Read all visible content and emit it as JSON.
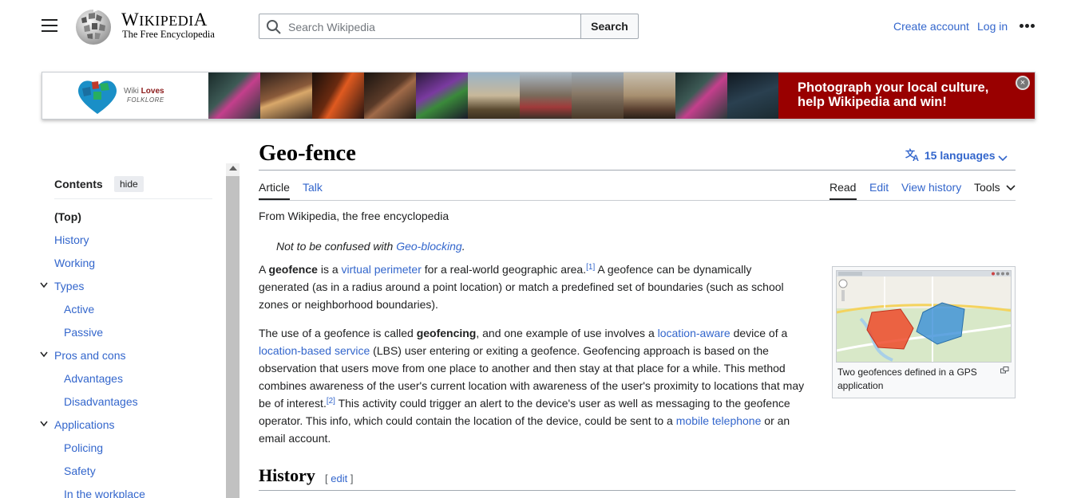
{
  "header": {
    "wordmark_first": "W",
    "wordmark_rest": "IKIPEDI",
    "wordmark_last": "A",
    "tagline": "The Free Encyclopedia",
    "search_placeholder": "Search Wikipedia",
    "search_button": "Search",
    "create_account": "Create account",
    "log_in": "Log in"
  },
  "banner": {
    "logo_text_wiki": "Wiki",
    "logo_text_loves": "Loves",
    "logo_text_folklore": "FOLKLORE",
    "promo": "Photograph your local culture, help Wikipedia and win!",
    "close_glyph": "×"
  },
  "toc": {
    "title": "Contents",
    "hide": "hide",
    "items": [
      {
        "label": "(Top)",
        "level": 1,
        "bold": true
      },
      {
        "label": "History",
        "level": 1
      },
      {
        "label": "Working",
        "level": 1
      },
      {
        "label": "Types",
        "level": 1,
        "expandable": true
      },
      {
        "label": "Active",
        "level": 2
      },
      {
        "label": "Passive",
        "level": 2
      },
      {
        "label": "Pros and cons",
        "level": 1,
        "expandable": true
      },
      {
        "label": "Advantages",
        "level": 2
      },
      {
        "label": "Disadvantages",
        "level": 2
      },
      {
        "label": "Applications",
        "level": 1,
        "expandable": true
      },
      {
        "label": "Policing",
        "level": 2
      },
      {
        "label": "Safety",
        "level": 2
      },
      {
        "label": "In the workplace",
        "level": 2
      }
    ]
  },
  "article": {
    "title": "Geo-fence",
    "languages": "15 languages",
    "tabs": {
      "article": "Article",
      "talk": "Talk",
      "read": "Read",
      "edit": "Edit",
      "view_history": "View history",
      "tools": "Tools"
    },
    "from_wiki": "From Wikipedia, the free encyclopedia",
    "hatnote_prefix": "Not to be confused with ",
    "hatnote_link": "Geo-blocking",
    "hatnote_suffix": ".",
    "p1": {
      "t1": "A ",
      "b1": "geofence",
      "t2": " is a ",
      "l1": "virtual perimeter",
      "t3": " for a real-world geographic area.",
      "ref1": "[1]",
      "t4": " A geofence can be dynamically",
      "line2": "generated (as in a radius around a point location) or match a predefined set of boundaries (such as school",
      "line3": "zones or neighborhood boundaries)."
    },
    "p2": {
      "t1": "The use of a geofence is called ",
      "b1": "geofencing",
      "t2": ", and one example of use involves a ",
      "l1": "location-aware",
      "t3": " device of a",
      "l2": "location-based service",
      "t4": " (LBS) user entering or exiting a geofence. Geofencing approach is based on the",
      "line3": "observation that users move from one place to another and then stay at that place for a while. This method",
      "line4": "combines awareness of the user's current location with awareness of the user's proximity to locations that may",
      "t5": "be of interest.",
      "ref2": "[2]",
      "t6": " This activity could trigger an alert to the device's user as well as messaging to the geofence",
      "t7": "operator. This info, which could contain the location of the device, could be sent to a ",
      "l3": "mobile telephone",
      "t8": " or an",
      "line7": "email account."
    },
    "figure_caption": "Two geofences defined in a GPS application",
    "h2_history": "History",
    "edit_open": "[ ",
    "edit_label": "edit",
    "edit_close": " ]"
  },
  "colors": {
    "link": "#3366cc",
    "banner_promo": "#990000"
  }
}
